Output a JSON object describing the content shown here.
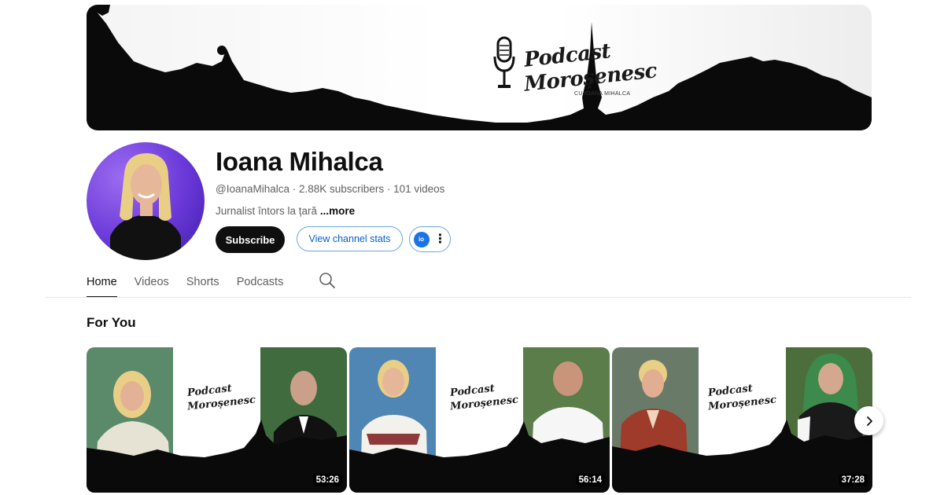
{
  "banner": {
    "logo_line1": "Podcast",
    "logo_line2": "Moroșenesc",
    "logo_sub": "CU IOANA MIHALCA"
  },
  "channel": {
    "name": "Ioana Mihalca",
    "handle": "@IoanaMihalca",
    "subscribers": "2.88K subscribers",
    "videos": "101 videos",
    "separator": " · ",
    "description": "Jurnalist întors la țară",
    "more_label": "...more"
  },
  "actions": {
    "subscribe_label": "Subscribe",
    "stats_label": "View channel stats",
    "ext_badge": "io"
  },
  "tabs": [
    {
      "label": "Home",
      "active": true
    },
    {
      "label": "Videos",
      "active": false
    },
    {
      "label": "Shorts",
      "active": false
    },
    {
      "label": "Podcasts",
      "active": false
    }
  ],
  "section": {
    "title": "For You"
  },
  "videos": [
    {
      "duration": "53:26",
      "logo1": "Podcast",
      "logo2": "Moroșenesc"
    },
    {
      "duration": "56:14",
      "logo1": "Podcast",
      "logo2": "Moroșenesc"
    },
    {
      "duration": "37:28",
      "logo1": "Podcast",
      "logo2": "Moroșenesc"
    }
  ],
  "icons": {
    "search": "search-icon",
    "next": "chevron-right-icon",
    "more": "kebab-menu-icon"
  },
  "colors": {
    "subscribe_bg": "#0f0f0f",
    "accent_link": "#065fd4",
    "avatar_bg": "#6a38d8"
  }
}
